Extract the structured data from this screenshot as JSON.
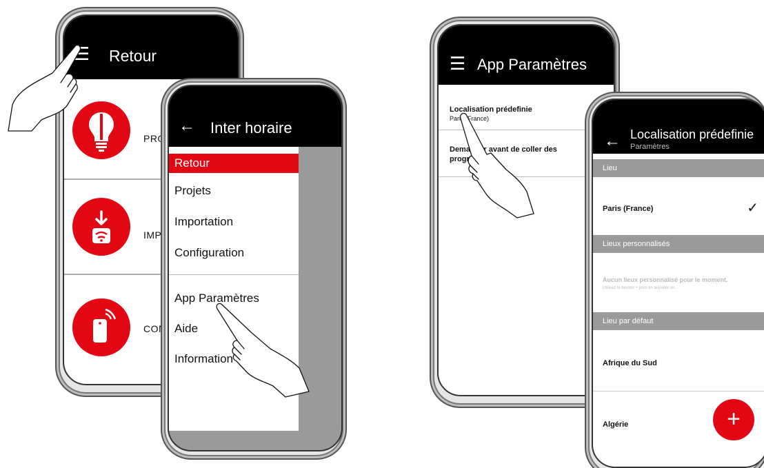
{
  "colors": {
    "accent": "#e30613",
    "appbar": "#000000",
    "drawer_backdrop": "#9a9a9a"
  },
  "phone_main": {
    "title": "Retour",
    "menu_icon": "hamburger-icon",
    "rows": [
      {
        "label": "PRO",
        "icon": "lightbulb-icon"
      },
      {
        "label": "IMPO",
        "icon": "download-wifi-icon"
      },
      {
        "label": "CONF",
        "icon": "remote-signal-icon"
      }
    ]
  },
  "phone_drawer": {
    "title": "Inter horaire",
    "back_icon": "back-arrow-icon",
    "items": [
      {
        "label": "Retour",
        "active": true
      },
      {
        "label": "Projets"
      },
      {
        "label": "Importation"
      },
      {
        "label": "Configuration"
      },
      {
        "label": "App Paramètres"
      },
      {
        "label": "Aide"
      },
      {
        "label": "Information"
      }
    ]
  },
  "phone_settings": {
    "title": "App Paramètres",
    "rows": [
      {
        "title": "Localisation prédefinie",
        "subtitle": "Paris (France)"
      },
      {
        "title_line1": "Demander avant de coller des",
        "title_line2": "programmes"
      }
    ]
  },
  "phone_location": {
    "title": "Localisation prédefinie",
    "subtitle": "Paramètres",
    "sections": {
      "lieu": "Lieu",
      "personnalises": "Lieux personnalisés",
      "defaut": "Lieu par défaut"
    },
    "selected": "Paris (France)",
    "empty_title": "Aucun lieux personnalisé pour le moment.",
    "empty_sub": "Utilisez le bouton + pour en aujouter un.",
    "defaults": [
      "Afrique du Sud",
      "Algérie"
    ],
    "fab_label": "+"
  }
}
